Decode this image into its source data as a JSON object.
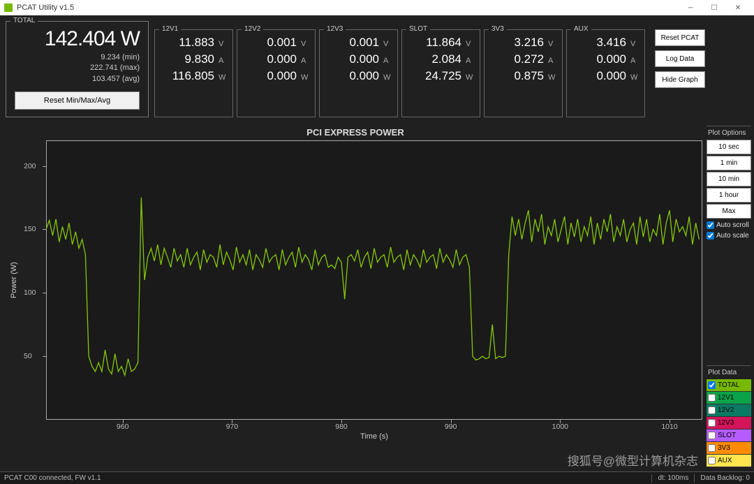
{
  "window": {
    "title": "PCAT Utility v1.5"
  },
  "total": {
    "label": "TOTAL",
    "value": "142.404 W",
    "min": "9.234 (min)",
    "max": "222.741 (max)",
    "avg": "103.457 (avg)",
    "reset_btn": "Reset Min/Max/Avg"
  },
  "rails": [
    {
      "name": "12V1",
      "v": "11.883",
      "a": "9.830",
      "w": "116.805"
    },
    {
      "name": "12V2",
      "v": "0.001",
      "a": "0.000",
      "w": "0.000"
    },
    {
      "name": "12V3",
      "v": "0.001",
      "a": "0.000",
      "w": "0.000"
    },
    {
      "name": "SLOT",
      "v": "11.864",
      "a": "2.084",
      "w": "24.725"
    },
    {
      "name": "3V3",
      "v": "3.216",
      "a": "0.272",
      "w": "0.875"
    },
    {
      "name": "AUX",
      "v": "3.416",
      "a": "0.000",
      "w": "0.000"
    }
  ],
  "actions": {
    "reset_pcat": "Reset PCAT",
    "log_data": "Log Data",
    "hide_graph": "Hide Graph"
  },
  "plot_options": {
    "title": "Plot Options",
    "buttons": [
      "10 sec",
      "1 min",
      "10 min",
      "1 hour",
      "Max"
    ],
    "auto_scroll": "Auto scroll",
    "auto_scale": "Auto scale"
  },
  "plot_data_legend": {
    "title": "Plot Data",
    "items": [
      {
        "label": "TOTAL",
        "color": "#76b900",
        "checked": true
      },
      {
        "label": "12V1",
        "color": "#0aa34a",
        "checked": false
      },
      {
        "label": "12V2",
        "color": "#0a7a63",
        "checked": false
      },
      {
        "label": "12V3",
        "color": "#d4145a",
        "checked": false
      },
      {
        "label": "SLOT",
        "color": "#b45cff",
        "checked": false
      },
      {
        "label": "3V3",
        "color": "#ff8c00",
        "checked": false
      },
      {
        "label": "AUX",
        "color": "#ffe550",
        "checked": false
      }
    ]
  },
  "chart_data": {
    "type": "line",
    "title": "PCI EXPRESS POWER",
    "xlabel": "Time (s)",
    "ylabel": "Power (W)",
    "xlim": [
      953,
      1013
    ],
    "ylim": [
      0,
      220
    ],
    "xticks": [
      960,
      970,
      980,
      990,
      1000,
      1010
    ],
    "yticks": [
      50,
      100,
      150,
      200
    ],
    "series": [
      {
        "name": "TOTAL",
        "color": "#85c808",
        "x": [
          953,
          953.3,
          953.6,
          953.9,
          954.2,
          954.5,
          954.8,
          955.1,
          955.4,
          955.7,
          956,
          956.3,
          956.6,
          956.9,
          957.2,
          957.5,
          957.8,
          958.1,
          958.4,
          958.7,
          959,
          959.3,
          959.6,
          959.9,
          960.2,
          960.5,
          960.8,
          961.1,
          961.4,
          961.7,
          962,
          962.3,
          962.6,
          962.9,
          963.2,
          963.5,
          963.8,
          964.1,
          964.4,
          964.7,
          965,
          965.3,
          965.6,
          965.9,
          966.2,
          966.5,
          966.8,
          967.1,
          967.4,
          967.7,
          968,
          968.3,
          968.6,
          968.9,
          969.2,
          969.5,
          969.8,
          970.1,
          970.4,
          970.7,
          971,
          971.3,
          971.6,
          971.9,
          972.2,
          972.5,
          972.8,
          973.1,
          973.4,
          973.7,
          974,
          974.3,
          974.6,
          974.9,
          975.2,
          975.5,
          975.8,
          976.1,
          976.4,
          976.7,
          977,
          977.3,
          977.6,
          977.9,
          978.2,
          978.5,
          978.8,
          979.1,
          979.4,
          979.7,
          980,
          980.3,
          980.6,
          980.9,
          981.2,
          981.5,
          981.8,
          982.1,
          982.4,
          982.7,
          983,
          983.3,
          983.6,
          983.9,
          984.2,
          984.5,
          984.8,
          985.1,
          985.4,
          985.7,
          986,
          986.3,
          986.6,
          986.9,
          987.2,
          987.5,
          987.8,
          988.1,
          988.4,
          988.7,
          989,
          989.3,
          989.6,
          989.9,
          990.2,
          990.5,
          990.8,
          991.1,
          991.4,
          991.7,
          992,
          992.3,
          992.6,
          992.9,
          993.2,
          993.5,
          993.8,
          994.1,
          994.4,
          994.7,
          995,
          995.3,
          995.6,
          995.9,
          996.2,
          996.5,
          996.8,
          997.1,
          997.4,
          997.7,
          998,
          998.3,
          998.6,
          998.9,
          999.2,
          999.5,
          999.8,
          1000.1,
          1000.4,
          1000.7,
          1001,
          1001.3,
          1001.6,
          1001.9,
          1002.2,
          1002.5,
          1002.8,
          1003.1,
          1003.4,
          1003.7,
          1004,
          1004.3,
          1004.6,
          1004.9,
          1005.2,
          1005.5,
          1005.8,
          1006.1,
          1006.4,
          1006.7,
          1007,
          1007.3,
          1007.6,
          1007.9,
          1008.2,
          1008.5,
          1008.8,
          1009.1,
          1009.4,
          1009.7,
          1010,
          1010.3,
          1010.6,
          1010.9,
          1011.2,
          1011.5,
          1011.8,
          1012.1,
          1012.4,
          1012.7,
          1013
        ],
        "y": [
          150,
          157,
          145,
          158,
          140,
          152,
          142,
          155,
          138,
          148,
          135,
          142,
          130,
          50,
          42,
          38,
          45,
          38,
          55,
          40,
          36,
          52,
          38,
          42,
          35,
          48,
          38,
          40,
          45,
          175,
          110,
          128,
          135,
          125,
          138,
          122,
          135,
          128,
          120,
          135,
          125,
          130,
          120,
          135,
          122,
          128,
          132,
          118,
          134,
          124,
          130,
          128,
          120,
          138,
          122,
          132,
          126,
          118,
          136,
          124,
          130,
          122,
          134,
          118,
          130,
          126,
          120,
          135,
          124,
          128,
          130,
          118,
          134,
          122,
          128,
          132,
          120,
          136,
          124,
          130,
          126,
          118,
          134,
          122,
          128,
          130,
          120,
          122,
          119,
          128,
          124,
          95,
          128,
          130,
          125,
          134,
          120,
          128,
          132,
          119,
          135,
          124,
          128,
          130,
          120,
          136,
          124,
          128,
          130,
          118,
          134,
          122,
          130,
          126,
          120,
          134,
          124,
          128,
          130,
          119,
          135,
          124,
          130,
          126,
          120,
          134,
          122,
          128,
          130,
          120,
          50,
          47,
          48,
          50,
          48,
          49,
          75,
          48,
          50,
          49,
          50,
          130,
          160,
          145,
          158,
          142,
          155,
          165,
          140,
          158,
          148,
          162,
          138,
          152,
          145,
          158,
          140,
          150,
          160,
          138,
          155,
          144,
          158,
          140,
          152,
          145,
          160,
          138,
          155,
          142,
          158,
          148,
          162,
          140,
          152,
          145,
          158,
          140,
          150,
          155,
          138,
          160,
          144,
          158,
          140,
          150,
          145,
          162,
          138,
          155,
          165,
          140,
          158,
          148,
          152,
          145,
          160,
          138,
          155,
          142
        ]
      }
    ]
  },
  "status": {
    "left": "PCAT C00 connected, FW v1.1",
    "dt": "dt: 100ms",
    "backlog": "Data Backlog: 0"
  },
  "watermark": "搜狐号@微型计算机杂志"
}
